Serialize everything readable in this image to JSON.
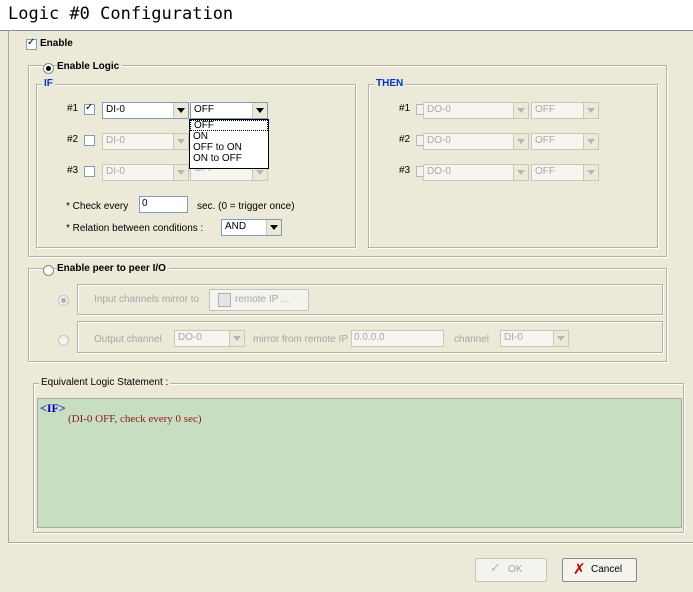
{
  "window": {
    "title": "Logic #0 Configuration"
  },
  "enable": {
    "label": "Enable",
    "checked": true
  },
  "logic": {
    "label": "Enable Logic",
    "selected": true,
    "if": {
      "title": "IF",
      "rows": [
        {
          "num": "#1",
          "checked": true,
          "channel": "DI-0",
          "state": "OFF"
        },
        {
          "num": "#2",
          "checked": false,
          "channel": "DI-0",
          "state": "OFF"
        },
        {
          "num": "#3",
          "checked": false,
          "channel": "DI-0",
          "state": "OFF"
        }
      ],
      "state_options": [
        "OFF",
        "ON",
        "OFF to ON",
        "ON to OFF"
      ],
      "check_every_label": "* Check every",
      "check_every_value": "0",
      "check_every_hint": "sec. (0 = trigger once)",
      "relation_label": "* Relation between conditions :",
      "relation_value": "AND"
    },
    "then": {
      "title": "THEN",
      "rows": [
        {
          "num": "#1",
          "checked": false,
          "channel": "DO-0",
          "state": "OFF"
        },
        {
          "num": "#2",
          "checked": false,
          "channel": "DO-0",
          "state": "OFF"
        },
        {
          "num": "#3",
          "checked": false,
          "channel": "DO-0",
          "state": "OFF"
        }
      ]
    }
  },
  "peer": {
    "label": "Enable peer to peer I/O",
    "input_mirror_label": "Input channels mirror to",
    "remote_button": "remote IP ...",
    "output_channel_label": "Output channel",
    "output_channel_value": "DO-0",
    "mirror_from_label": "mirror from remote IP",
    "remote_ip_value": "0.0.0.0",
    "channel_label": "channel",
    "channel_value": "DI-0"
  },
  "statement": {
    "label": "Equivalent Logic Statement :",
    "tag": "<IF>",
    "line": "(DI-0 OFF, check every 0 sec)"
  },
  "buttons": {
    "ok": "OK",
    "cancel": "Cancel"
  },
  "colors": {
    "statement_bg": "#c7dfc0",
    "statement_tag": "#0000cc",
    "statement_line": "#8b1a1a",
    "group_title": "#0036c8",
    "cancel_x": "#c40000"
  }
}
